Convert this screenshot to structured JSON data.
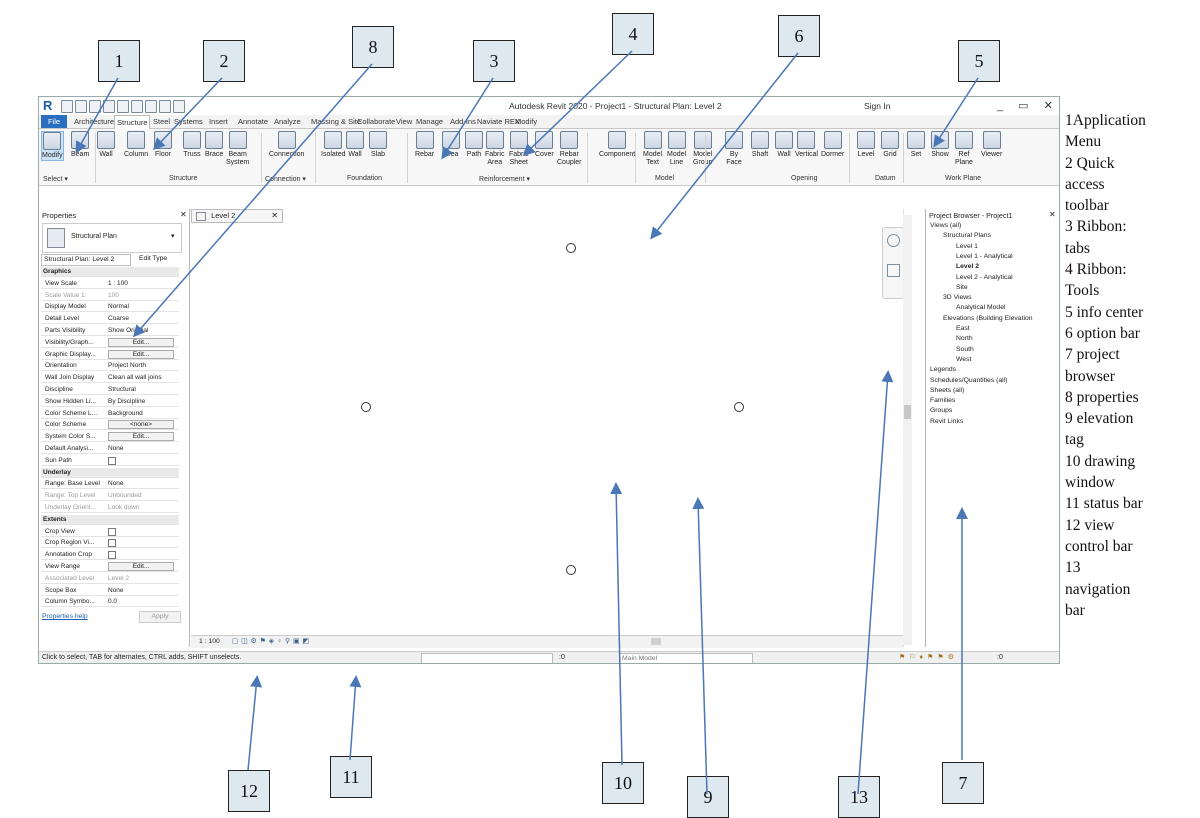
{
  "window": {
    "title": "Autodesk Revit 2020 - Project1 - Structural Plan: Level 2",
    "sign_in": "Sign In",
    "app_button": "R",
    "controls": "_ ▭ ✕"
  },
  "tabs": [
    "File",
    "Architecture",
    "Structure",
    "Steel",
    "Systems",
    "Insert",
    "Annotate",
    "Analyze",
    "Massing & Site",
    "Collaborate",
    "View",
    "Manage",
    "Add-Ins",
    "Naviate REX",
    "Modify"
  ],
  "ribbon": {
    "tools": [
      {
        "label": "Modify",
        "sub": ""
      },
      {
        "label": "Beam",
        "sub": ""
      },
      {
        "label": "Wall",
        "sub": ""
      },
      {
        "label": "Column",
        "sub": ""
      },
      {
        "label": "Floor",
        "sub": ""
      },
      {
        "label": "Truss",
        "sub": ""
      },
      {
        "label": "Brace",
        "sub": ""
      },
      {
        "label": "Beam",
        "sub": "System"
      },
      {
        "label": "Connection",
        "sub": ""
      },
      {
        "label": "Isolated",
        "sub": ""
      },
      {
        "label": "Wall",
        "sub": ""
      },
      {
        "label": "Slab",
        "sub": ""
      },
      {
        "label": "Rebar",
        "sub": ""
      },
      {
        "label": "Area",
        "sub": ""
      },
      {
        "label": "Path",
        "sub": ""
      },
      {
        "label": "Fabric",
        "sub": "Area"
      },
      {
        "label": "Fabric",
        "sub": "Sheet"
      },
      {
        "label": "Cover",
        "sub": ""
      },
      {
        "label": "Rebar",
        "sub": "Coupler"
      },
      {
        "label": "Component",
        "sub": ""
      },
      {
        "label": "Model",
        "sub": "Text"
      },
      {
        "label": "Model",
        "sub": "Line"
      },
      {
        "label": "Model",
        "sub": "Group"
      },
      {
        "label": "By",
        "sub": "Face"
      },
      {
        "label": "Shaft",
        "sub": ""
      },
      {
        "label": "Wall",
        "sub": ""
      },
      {
        "label": "Vertical",
        "sub": ""
      },
      {
        "label": "Dormer",
        "sub": ""
      },
      {
        "label": "Level",
        "sub": ""
      },
      {
        "label": "Grid",
        "sub": ""
      },
      {
        "label": "Set",
        "sub": ""
      },
      {
        "label": "Show",
        "sub": ""
      },
      {
        "label": "Ref",
        "sub": "Plane"
      },
      {
        "label": "Viewer",
        "sub": ""
      }
    ],
    "groups": [
      "Select ▾",
      "Structure",
      "Connection ▾",
      "Foundation",
      "Reinforcement ▾",
      "Model",
      "Opening",
      "Datum",
      "Work Plane"
    ]
  },
  "properties": {
    "header": "Properties",
    "type_name": "Structural Plan",
    "instance": "Structural Plan: Level 2",
    "edit_type": "Edit Type",
    "help": "Properties help",
    "apply": "Apply",
    "rows": [
      {
        "k": "Graphics",
        "v": "",
        "sec": true
      },
      {
        "k": "View Scale",
        "v": "1 : 100"
      },
      {
        "k": "Scale Value    1:",
        "v": "100",
        "dim": true
      },
      {
        "k": "Display Model",
        "v": "Normal"
      },
      {
        "k": "Detail Level",
        "v": "Coarse"
      },
      {
        "k": "Parts Visibility",
        "v": "Show Original"
      },
      {
        "k": "Visibility/Graph...",
        "v": "Edit...",
        "btn": true
      },
      {
        "k": "Graphic Display...",
        "v": "Edit...",
        "btn": true
      },
      {
        "k": "Orientation",
        "v": "Project North"
      },
      {
        "k": "Wall Join Display",
        "v": "Clean all wall joins"
      },
      {
        "k": "Discipline",
        "v": "Structural"
      },
      {
        "k": "Show Hidden Li...",
        "v": "By Discipline"
      },
      {
        "k": "Color Scheme L...",
        "v": "Background"
      },
      {
        "k": "Color Scheme",
        "v": "<none>",
        "btn": true
      },
      {
        "k": "System Color S...",
        "v": "Edit...",
        "btn": true
      },
      {
        "k": "Default Analysi...",
        "v": "None"
      },
      {
        "k": "Sun Path",
        "v": "",
        "chk": true
      },
      {
        "k": "Underlay",
        "v": "",
        "sec": true
      },
      {
        "k": "Range: Base Level",
        "v": "None"
      },
      {
        "k": "Range: Top Level",
        "v": "Unbounded",
        "dim": true
      },
      {
        "k": "Underlay Orient...",
        "v": "Look down",
        "dim": true
      },
      {
        "k": "Extents",
        "v": "",
        "sec": true
      },
      {
        "k": "Crop View",
        "v": "",
        "chk": true
      },
      {
        "k": "Crop Region Vi...",
        "v": "",
        "chk": true
      },
      {
        "k": "Annotation Crop",
        "v": "",
        "chk": true
      },
      {
        "k": "View Range",
        "v": "Edit...",
        "btn": true
      },
      {
        "k": "Associated Level",
        "v": "Level 2",
        "dim": true
      },
      {
        "k": "Scope Box",
        "v": "None"
      },
      {
        "k": "Column Symbo...",
        "v": "0.0"
      }
    ]
  },
  "view_tab": "Level 2",
  "project_browser": {
    "header": "Project Browser - Project1",
    "items": [
      {
        "t": "Views (all)",
        "d": 0
      },
      {
        "t": "Structural Plans",
        "d": 1
      },
      {
        "t": "Level 1",
        "d": 2
      },
      {
        "t": "Level 1 - Analytical",
        "d": 2
      },
      {
        "t": "Level 2",
        "d": 2,
        "b": true
      },
      {
        "t": "Level 2 - Analytical",
        "d": 2
      },
      {
        "t": "Site",
        "d": 2
      },
      {
        "t": "3D Views",
        "d": 1
      },
      {
        "t": "Analytical Model",
        "d": 2
      },
      {
        "t": "Elevations (Building Elevation",
        "d": 1
      },
      {
        "t": "East",
        "d": 2
      },
      {
        "t": "North",
        "d": 2
      },
      {
        "t": "South",
        "d": 2
      },
      {
        "t": "West",
        "d": 2
      },
      {
        "t": "Legends",
        "d": 0
      },
      {
        "t": "Schedules/Quantities (all)",
        "d": 0
      },
      {
        "t": "Sheets (all)",
        "d": 0
      },
      {
        "t": "Families",
        "d": 0
      },
      {
        "t": "Groups",
        "d": 0
      },
      {
        "t": "Revit Links",
        "d": 0
      }
    ]
  },
  "view_control": {
    "scale": "1 : 100"
  },
  "status_bar": {
    "hint": "Click to select, TAB for alternates, CTRL adds, SHIFT unselects.",
    "count": ":0",
    "model": "Main Model",
    "filter": ":0"
  },
  "callouts": [
    "1",
    "2",
    "3",
    "4",
    "5",
    "6",
    "7",
    "8",
    "9",
    "10",
    "11",
    "12",
    "13"
  ],
  "legend": [
    "1Application",
    "Menu",
    "2 Quick",
    "access",
    "toolbar",
    "3 Ribbon:",
    "tabs",
    "4 Ribbon:",
    "Tools",
    "5 info center",
    "6 option bar",
    "7 project",
    "browser",
    "8 properties",
    "9 elevation",
    "tag",
    "10 drawing",
    "window",
    "11 status bar",
    "12 view",
    "control bar",
    "13",
    "navigation",
    "bar"
  ],
  "colors": {
    "file_tab": "#2a6fbf",
    "callout_fill": "#dde8ef",
    "arrow": "#4a77b5"
  }
}
